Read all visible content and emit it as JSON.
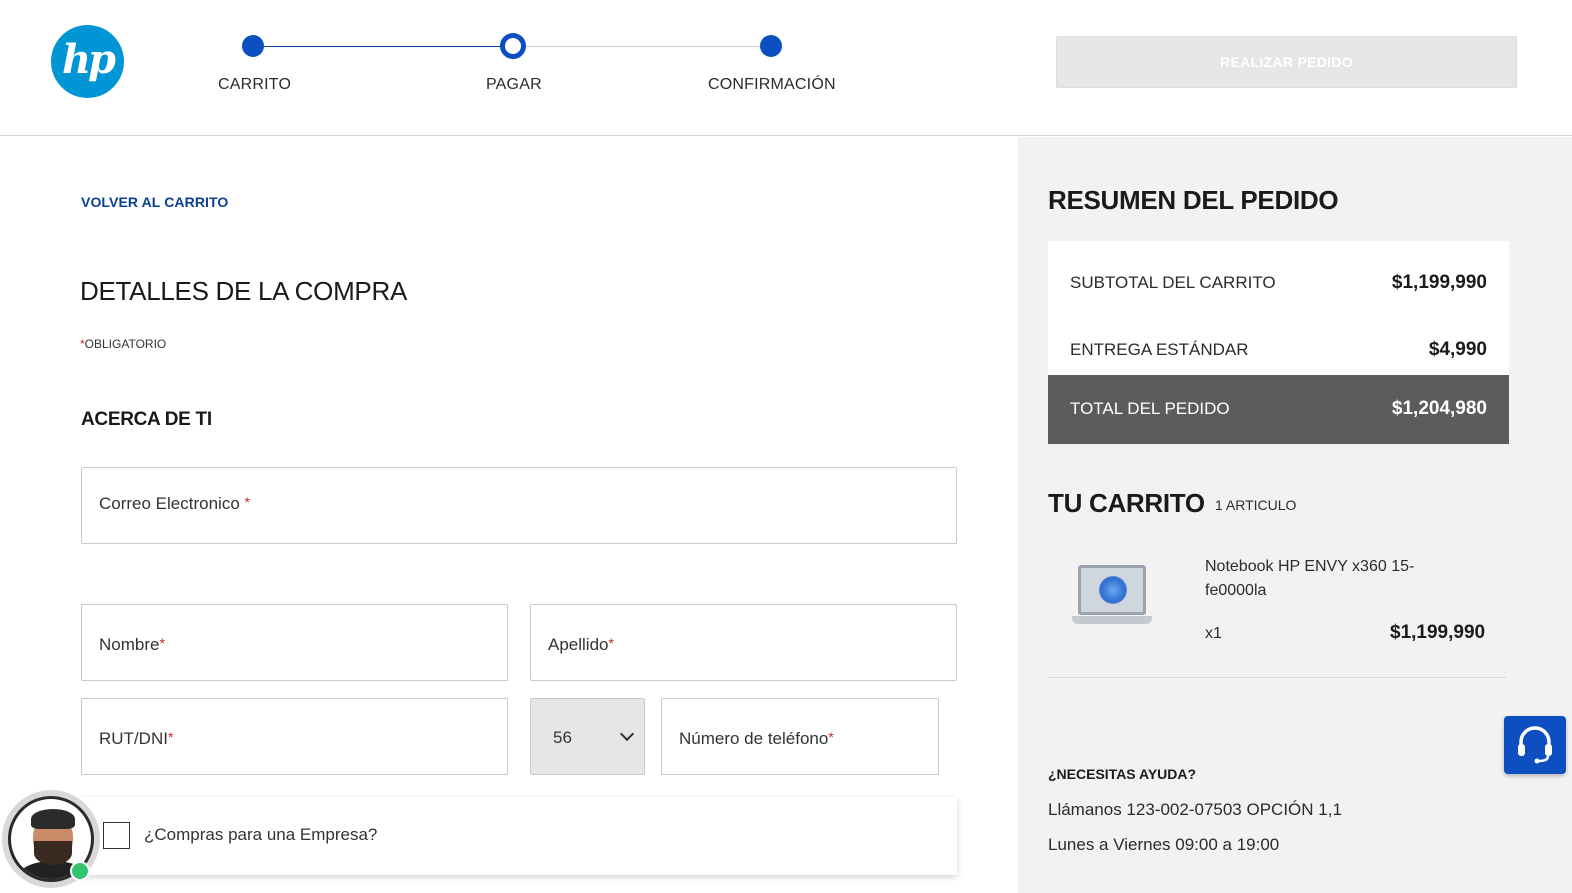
{
  "header": {
    "logo_text": "hp",
    "steps": [
      {
        "label": "CARRITO"
      },
      {
        "label": "PAGAR"
      },
      {
        "label": "CONFIRMACIÓN"
      }
    ],
    "place_order_label": "REALIZAR PEDIDO"
  },
  "main": {
    "back_link": "VOLVER AL CARRITO",
    "title": "DETALLES DE LA COMPRA",
    "required_star": "*",
    "required_note": "OBLIGATORIO",
    "section_title": "ACERCA DE TI",
    "fields": {
      "email": "Correo Electronico",
      "nombre": "Nombre",
      "apellido": "Apellido",
      "rut": "RUT/DNI",
      "country_code": "56",
      "phone": "Número de teléfono"
    },
    "company_label": "¿Compras para una Empresa?"
  },
  "summary": {
    "title": "RESUMEN DEL PEDIDO",
    "subtotal_label": "SUBTOTAL DEL CARRITO",
    "subtotal_value": "$1,199,990",
    "delivery_label": "ENTREGA ESTÁNDAR",
    "delivery_value": "$4,990",
    "total_label": "TOTAL DEL PEDIDO",
    "total_value": "$1,204,980"
  },
  "cart": {
    "title": "TU CARRITO",
    "count": "1 ARTICULO",
    "item": {
      "name": "Notebook HP ENVY x360 15-fe0000la",
      "qty": "x1",
      "price": "$1,199,990"
    }
  },
  "help": {
    "title": "¿NECESITAS AYUDA?",
    "phone": "Llámanos 123-002-07503 OPCIÓN 1,1",
    "hours": "Lunes a Viernes 09:00 a 19:00"
  },
  "colors": {
    "accent": "#0d4fc0",
    "logo": "#0096d6",
    "required": "#d2232a",
    "total_bg": "#5c5c5c",
    "panel_bg": "#f2f2f2"
  },
  "icons": {
    "logo": "hp-logo",
    "chat": "headset-chat-icon",
    "dropdown": "chevron-down-icon",
    "agent": "agent-avatar"
  }
}
